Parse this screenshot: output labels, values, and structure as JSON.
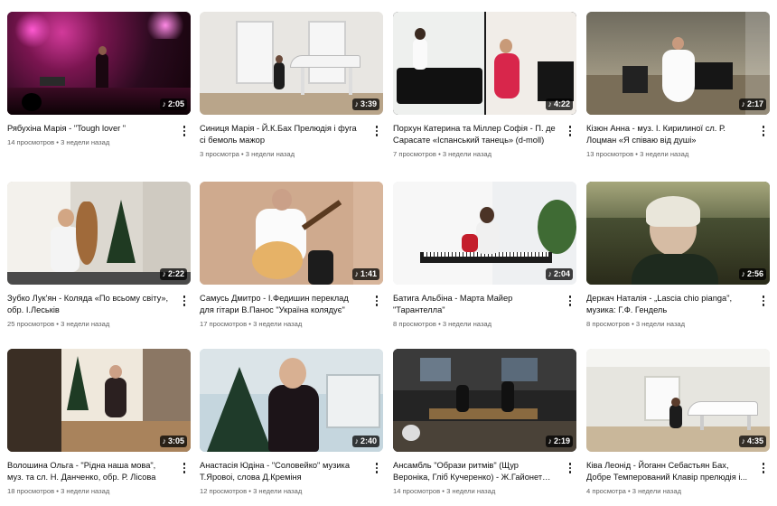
{
  "videos": [
    {
      "title": "Рябухіна Марія - \"Tough lover \"",
      "duration": "2:05",
      "views": "14 просмотров",
      "age": "3 недели назад"
    },
    {
      "title": "Синиця Марія - Й.К.Бах Прелюдія і фуга сі бемоль мажор",
      "duration": "3:39",
      "views": "3 просмотра",
      "age": "3 недели назад"
    },
    {
      "title": "Порхун Катерина та Міллер Софія - П. де Сарасате «Іспанський танець» (d-moll)",
      "duration": "4:22",
      "views": "7 просмотров",
      "age": "3 недели назад"
    },
    {
      "title": "Кізюн Анна - муз. І. Кирилиної сл. Р. Лоцман «Я співаю від душі»",
      "duration": "2:17",
      "views": "13 просмотров",
      "age": "3 недели назад"
    },
    {
      "title": "Зубко Лук'ян - Коляда «По всьому світу», обр. І.Леськів",
      "duration": "2:22",
      "views": "25 просмотров",
      "age": "3 недели назад"
    },
    {
      "title": "Самусь Дмитро - І.Федишин переклад для гітари В.Панос \"Україна колядує\"",
      "duration": "1:41",
      "views": "17 просмотров",
      "age": "3 недели назад"
    },
    {
      "title": "Батига Альбіна - Марта Майер \"Тарантелла\"",
      "duration": "2:04",
      "views": "8 просмотров",
      "age": "3 недели назад"
    },
    {
      "title": "Деркач Наталія - „Lascia chio pianga\", музика: Г.Ф. Гендель",
      "duration": "2:56",
      "views": "8 просмотров",
      "age": "3 недели назад"
    },
    {
      "title": "Волошина Ольга - \"Рідна наша мова\", муз. та сл. Н. Данченко, обр. Р. Лісова",
      "duration": "3:05",
      "views": "18 просмотров",
      "age": "3 недели назад"
    },
    {
      "title": "Анастасія Юдіна - \"Соловейко\" музика Т.Яровоі, слова Д.Креміня",
      "duration": "2:40",
      "views": "12 просмотров",
      "age": "3 недели назад"
    },
    {
      "title": "Ансамбль \"Образи ритмів\" (Щур Вероніка, Гліб Кучеренко) - Ж.Гайонет \"Джазова...",
      "duration": "2:19",
      "views": "14 просмотров",
      "age": "3 недели назад"
    },
    {
      "title": "Ківа Леонід - Йоганн Себастьян Бах, Добре Темперований Клавір прелюдія і...",
      "duration": "4:35",
      "views": "4 просмотра",
      "age": "3 недели назад"
    }
  ],
  "thumbnail_colors": [
    "#2a0a1e",
    "#e6e4df",
    "#1b1b1b",
    "#8f8a78",
    "#d9d4cc",
    "#c9a78c",
    "#e9ecef",
    "#4f5236",
    "#5b4a3c",
    "#bcd0d8",
    "#2b2b2b",
    "#e4e3dd"
  ],
  "icons": {
    "more": "more-vert-icon",
    "shorts": "music-note-icon"
  }
}
